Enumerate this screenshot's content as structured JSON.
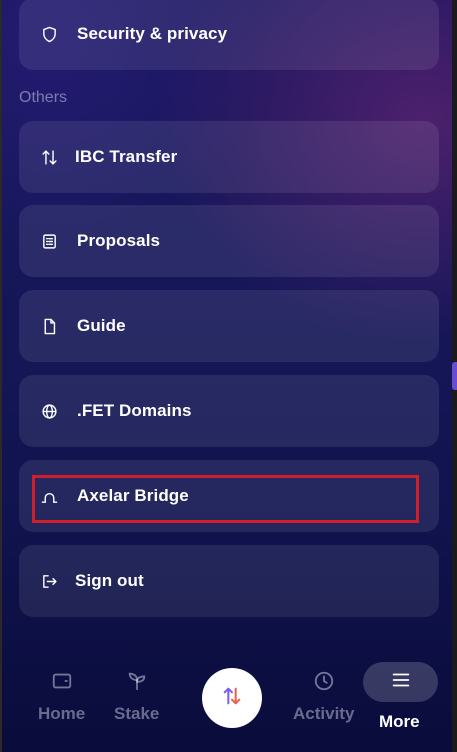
{
  "menu": {
    "security": {
      "label": "Security & privacy",
      "icon": "shield-icon"
    },
    "section_title": "Others",
    "items": [
      {
        "label": "IBC Transfer",
        "icon": "arrows-transfer-icon"
      },
      {
        "label": "Proposals",
        "icon": "document-list-icon"
      },
      {
        "label": "Guide",
        "icon": "document-icon"
      },
      {
        "label": ".FET Domains",
        "icon": "globe-icon"
      },
      {
        "label": "Axelar Bridge",
        "icon": "bridge-icon"
      },
      {
        "label": "Sign out",
        "icon": "sign-out-icon"
      }
    ]
  },
  "bottom_nav": {
    "home": "Home",
    "stake": "Stake",
    "swap_icon": "swap-arrows-icon",
    "activity": "Activity",
    "more": "More"
  },
  "colors": {
    "highlight_border": "#d01e2a",
    "swap_up": "#7b5cf0",
    "swap_down": "#e8604c"
  }
}
